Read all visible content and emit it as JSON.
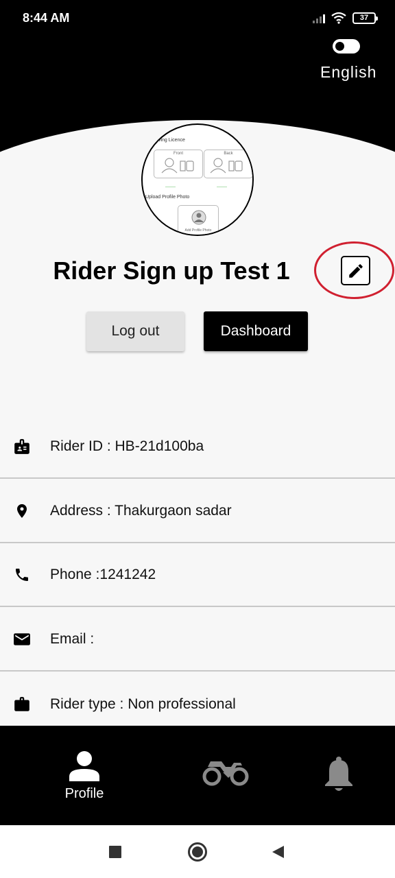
{
  "status_bar": {
    "time": "8:44 AM",
    "battery": "37"
  },
  "language": {
    "label": "English"
  },
  "avatar_preview": {
    "driving_licence_title": "Driving Licence",
    "front_label": "Front",
    "back_label": "Back",
    "upload_profile_title": "Upload Profile Photo",
    "add_profile_photo": "Add Profile Photo"
  },
  "profile": {
    "name": "Rider Sign up Test 1"
  },
  "actions": {
    "logout": "Log out",
    "dashboard": "Dashboard"
  },
  "info": [
    {
      "icon": "id-badge-icon",
      "text": "Rider ID : HB-21d100ba"
    },
    {
      "icon": "location-pin-icon",
      "text": "Address : Thakurgaon sadar"
    },
    {
      "icon": "phone-icon",
      "text": "Phone :1241242"
    },
    {
      "icon": "email-icon",
      "text": "Email :"
    },
    {
      "icon": "briefcase-icon",
      "text": "Rider type : Non professional"
    }
  ],
  "bottom_nav": {
    "profile_label": "Profile"
  },
  "colors": {
    "header": "#000000",
    "highlight_ring": "#d02030",
    "background": "#f7f7f7"
  }
}
